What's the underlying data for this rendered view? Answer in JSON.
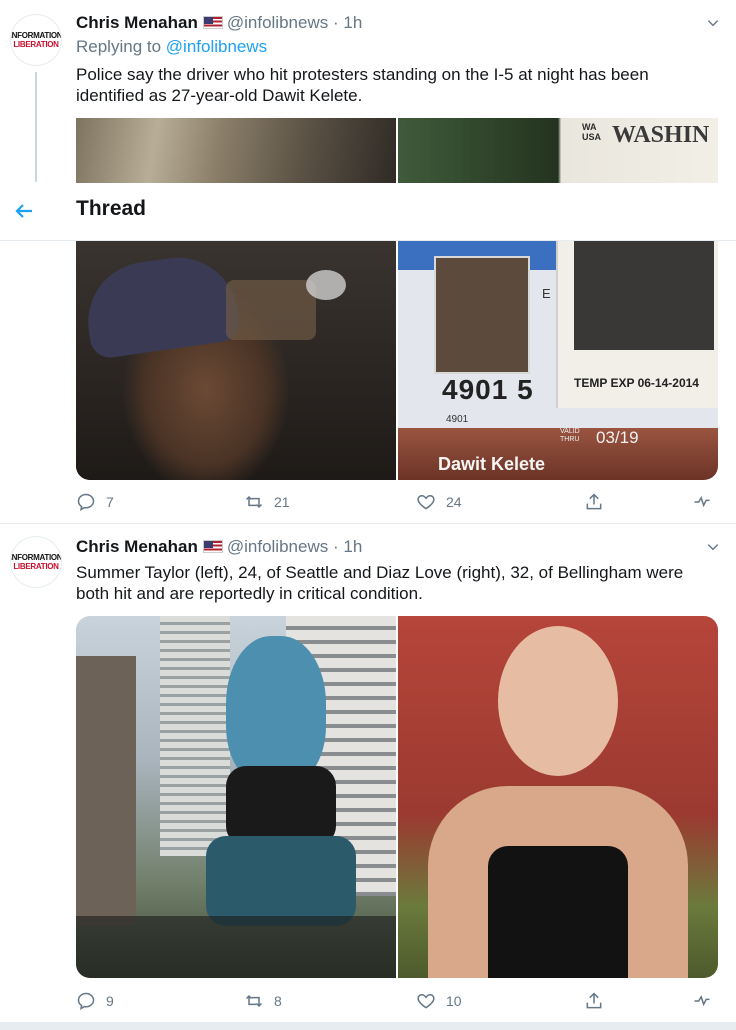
{
  "thread_header": {
    "title": "Thread"
  },
  "tweet1": {
    "avatar": {
      "line1": "INFORMATION",
      "line2": "LIBERATION"
    },
    "name": "Chris Menahan",
    "handle": "@infolibnews",
    "separator": "·",
    "time": "1h",
    "reply_prefix": "Replying to",
    "reply_handle": "@infolibnews",
    "text": "Police say the driver who hit protesters standing on the I-5 at night has been identified as 27-year-old Dawit Kelete.",
    "license_top": {
      "state": "WA",
      "country": "USA",
      "word": "WASHIN"
    },
    "license": {
      "letter": "E",
      "number": "4901 5",
      "small_number": "4901",
      "valid_label": "VALID\nTHRU",
      "valid_date": "03/19",
      "name": "Dawit Kelete",
      "temp_exp": "TEMP EXP 06-14-2014"
    },
    "actions": {
      "replies": "7",
      "retweets": "21",
      "likes": "24"
    }
  },
  "tweet2": {
    "avatar": {
      "line1": "INFORMATION",
      "line2": "LIBERATION"
    },
    "name": "Chris Menahan",
    "handle": "@infolibnews",
    "separator": "·",
    "time": "1h",
    "text": "Summer Taylor (left), 24, of Seattle and Diaz Love (right), 32, of Bellingham were both hit and are reportedly in critical condition.",
    "actions": {
      "replies": "9",
      "retweets": "8",
      "likes": "10"
    }
  },
  "colors": {
    "accent": "#1da1f2",
    "muted": "#657786",
    "text": "#14171a"
  },
  "icons": [
    "back-arrow-icon",
    "reply-icon",
    "retweet-icon",
    "like-icon",
    "share-icon",
    "analytics-icon",
    "chevron-down-icon",
    "us-flag-icon"
  ]
}
